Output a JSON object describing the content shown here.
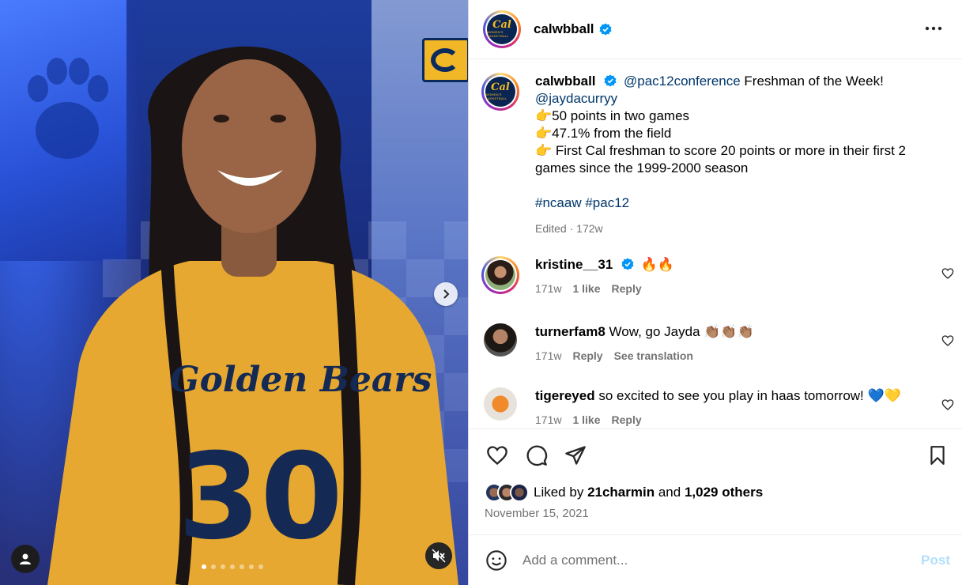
{
  "post": {
    "username": "calwbball",
    "avatar_text": "Cal",
    "avatar_subtext": "WOMEN'S BASKETBALL"
  },
  "media": {
    "jersey_text": "Golden Bears",
    "jersey_number": "30",
    "slide_count": 7,
    "active_slide": 0
  },
  "caption": {
    "username": "calwbball",
    "mention1": "@pac12conference",
    "line1_rest": " Freshman of the Week!",
    "mention2": "@jaydacurryy",
    "line2": "👉50 points in two games",
    "line3": "👉47.1% from the field",
    "line4": "👉 First Cal freshman to score 20 points or more in their first 2 games since the 1999-2000 season",
    "hashtag1": "#ncaaw",
    "hashtag2": "#pac12",
    "edited": "Edited",
    "dot": " · ",
    "age": "172w"
  },
  "comments": [
    {
      "username": "kristine__31",
      "verified": true,
      "text": "🔥🔥",
      "age": "171w",
      "likes": "1 like",
      "reply": "Reply",
      "extra": ""
    },
    {
      "username": "turnerfam8",
      "verified": false,
      "text": "Wow, go Jayda 👏🏽👏🏽👏🏽",
      "age": "171w",
      "likes": "",
      "reply": "Reply",
      "extra": "See translation"
    },
    {
      "username": "tigereyed",
      "verified": false,
      "text": "so excited to see you play in haas tomorrow! 💙💛",
      "age": "171w",
      "likes": "1 like",
      "reply": "Reply",
      "extra": ""
    }
  ],
  "engagement": {
    "liked_by_prefix": "Liked by ",
    "liked_by_user": "21charmin",
    "and": " and ",
    "others": "1,029 others",
    "date": "November 15, 2021"
  },
  "composer": {
    "placeholder": "Add a comment...",
    "post_label": "Post"
  },
  "colors": {
    "link": "#00376b",
    "muted": "#737373",
    "verified": "#0095f6",
    "cal_navy": "#0a2552",
    "cal_gold": "#f5b921"
  }
}
